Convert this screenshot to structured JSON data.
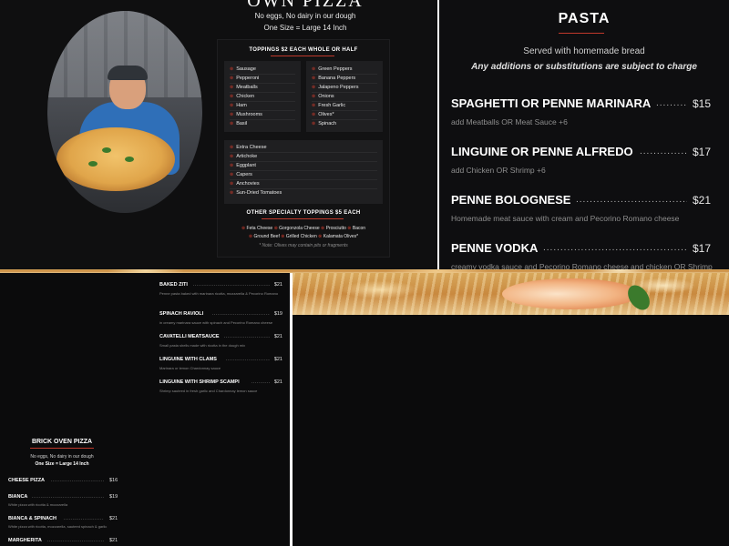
{
  "pizza_panel": {
    "title": "OWN PIZZA",
    "line1": "No eggs, No dairy in our dough",
    "line2": "One Size = Large 14 Inch",
    "toppings_header": "TOPPINGS $2 EACH WHOLE OR HALF",
    "toppings_left": [
      "Sausage",
      "Pepperoni",
      "Meatballs",
      "Chicken",
      "Ham",
      "Mushrooms",
      "Basil"
    ],
    "toppings_right": [
      "Green Peppers",
      "Banana Peppers",
      "Jalapeno Peppers",
      "Onions",
      "Fresh Garlic",
      "Olives*",
      "Spinach"
    ],
    "toppings_extra": [
      "Extra Cheese",
      "Artichoke",
      "Eggplant",
      "Capers",
      "Anchovies",
      "Sun-Dried Tomatoes"
    ],
    "specialty_header": "OTHER SPECIALTY TOPPINGS $5 EACH",
    "specialty_row1": [
      "Feta Cheese",
      "Gorgonzola Cheese",
      "Prosciutto",
      "Bacon"
    ],
    "specialty_row2": [
      "Ground Beef",
      "Grilled Chicken",
      "Kalamata Olives*"
    ],
    "note": "* Note: Olives may contain pits or fragments",
    "dot": "⊗"
  },
  "pasta": {
    "title": "PASTA",
    "subtitle": "Served with homemade bread",
    "note": "Any additions or substitutions are subject to charge",
    "dots": "...................................................",
    "items": [
      {
        "name": "SPAGHETTI OR PENNE MARINARA",
        "price": "$15",
        "desc": "add Meatballs OR Meat Sauce +6"
      },
      {
        "name": "LINGUINE OR PENNE ALFREDO",
        "price": "$17",
        "desc": "add Chicken OR Shrimp +6"
      },
      {
        "name": "PENNE BOLOGNESE",
        "price": "$21",
        "desc": "Homemade meat sauce with cream and Pecorino Romano cheese"
      },
      {
        "name": "PENNE VODKA",
        "price": "$17",
        "desc": "creamy vodka sauce and Pecorino Romano cheese and chicken OR Shrimp"
      }
    ]
  },
  "small_pasta": {
    "dots": "..........................................................",
    "items": [
      {
        "name": "BAKED ZITI",
        "price": "$21",
        "desc": "Penne pasta baked with marinara ricotta, mozzarella & Pecorino Romano"
      },
      {
        "name": "SPINACH RAVIOLI",
        "price": "$19",
        "desc": "in creamy marinara sauce with spinach and Pecorino Romano cheese"
      },
      {
        "name": "CAVATELLI MEATSAUCE",
        "price": "$21",
        "desc": "Small pasta shells made with ricotta in the dough mix"
      },
      {
        "name": "LINGUINE WITH CLAMS",
        "price": "$21",
        "desc": "Marinara or lemon Chardonnay sauce"
      },
      {
        "name": "LINGUINE WITH SHRIMP SCAMPI",
        "price": "$21",
        "desc": "Shrimp sauteed in fresh garlic and Chardonnay lemon sauce"
      }
    ]
  },
  "brick_oven": {
    "title": "BRICK OVEN PIZZA",
    "line1": "No eggs, No dairy in our dough",
    "line2": "One Size = Large 14 Inch",
    "dots": "..........................................................",
    "items": [
      {
        "name": "CHEESE PIZZA",
        "price": "$16",
        "desc": ""
      },
      {
        "name": "BIANCA",
        "price": "$19",
        "desc": "White pizza with ricotta & mozzarella"
      },
      {
        "name": "BIANCA & SPINACH",
        "price": "$21",
        "desc": "White pizza with ricotta, mozzarella, sauteed spinach & garlic"
      },
      {
        "name": "MARGHERITA",
        "price": "$21",
        "desc": ""
      }
    ]
  }
}
